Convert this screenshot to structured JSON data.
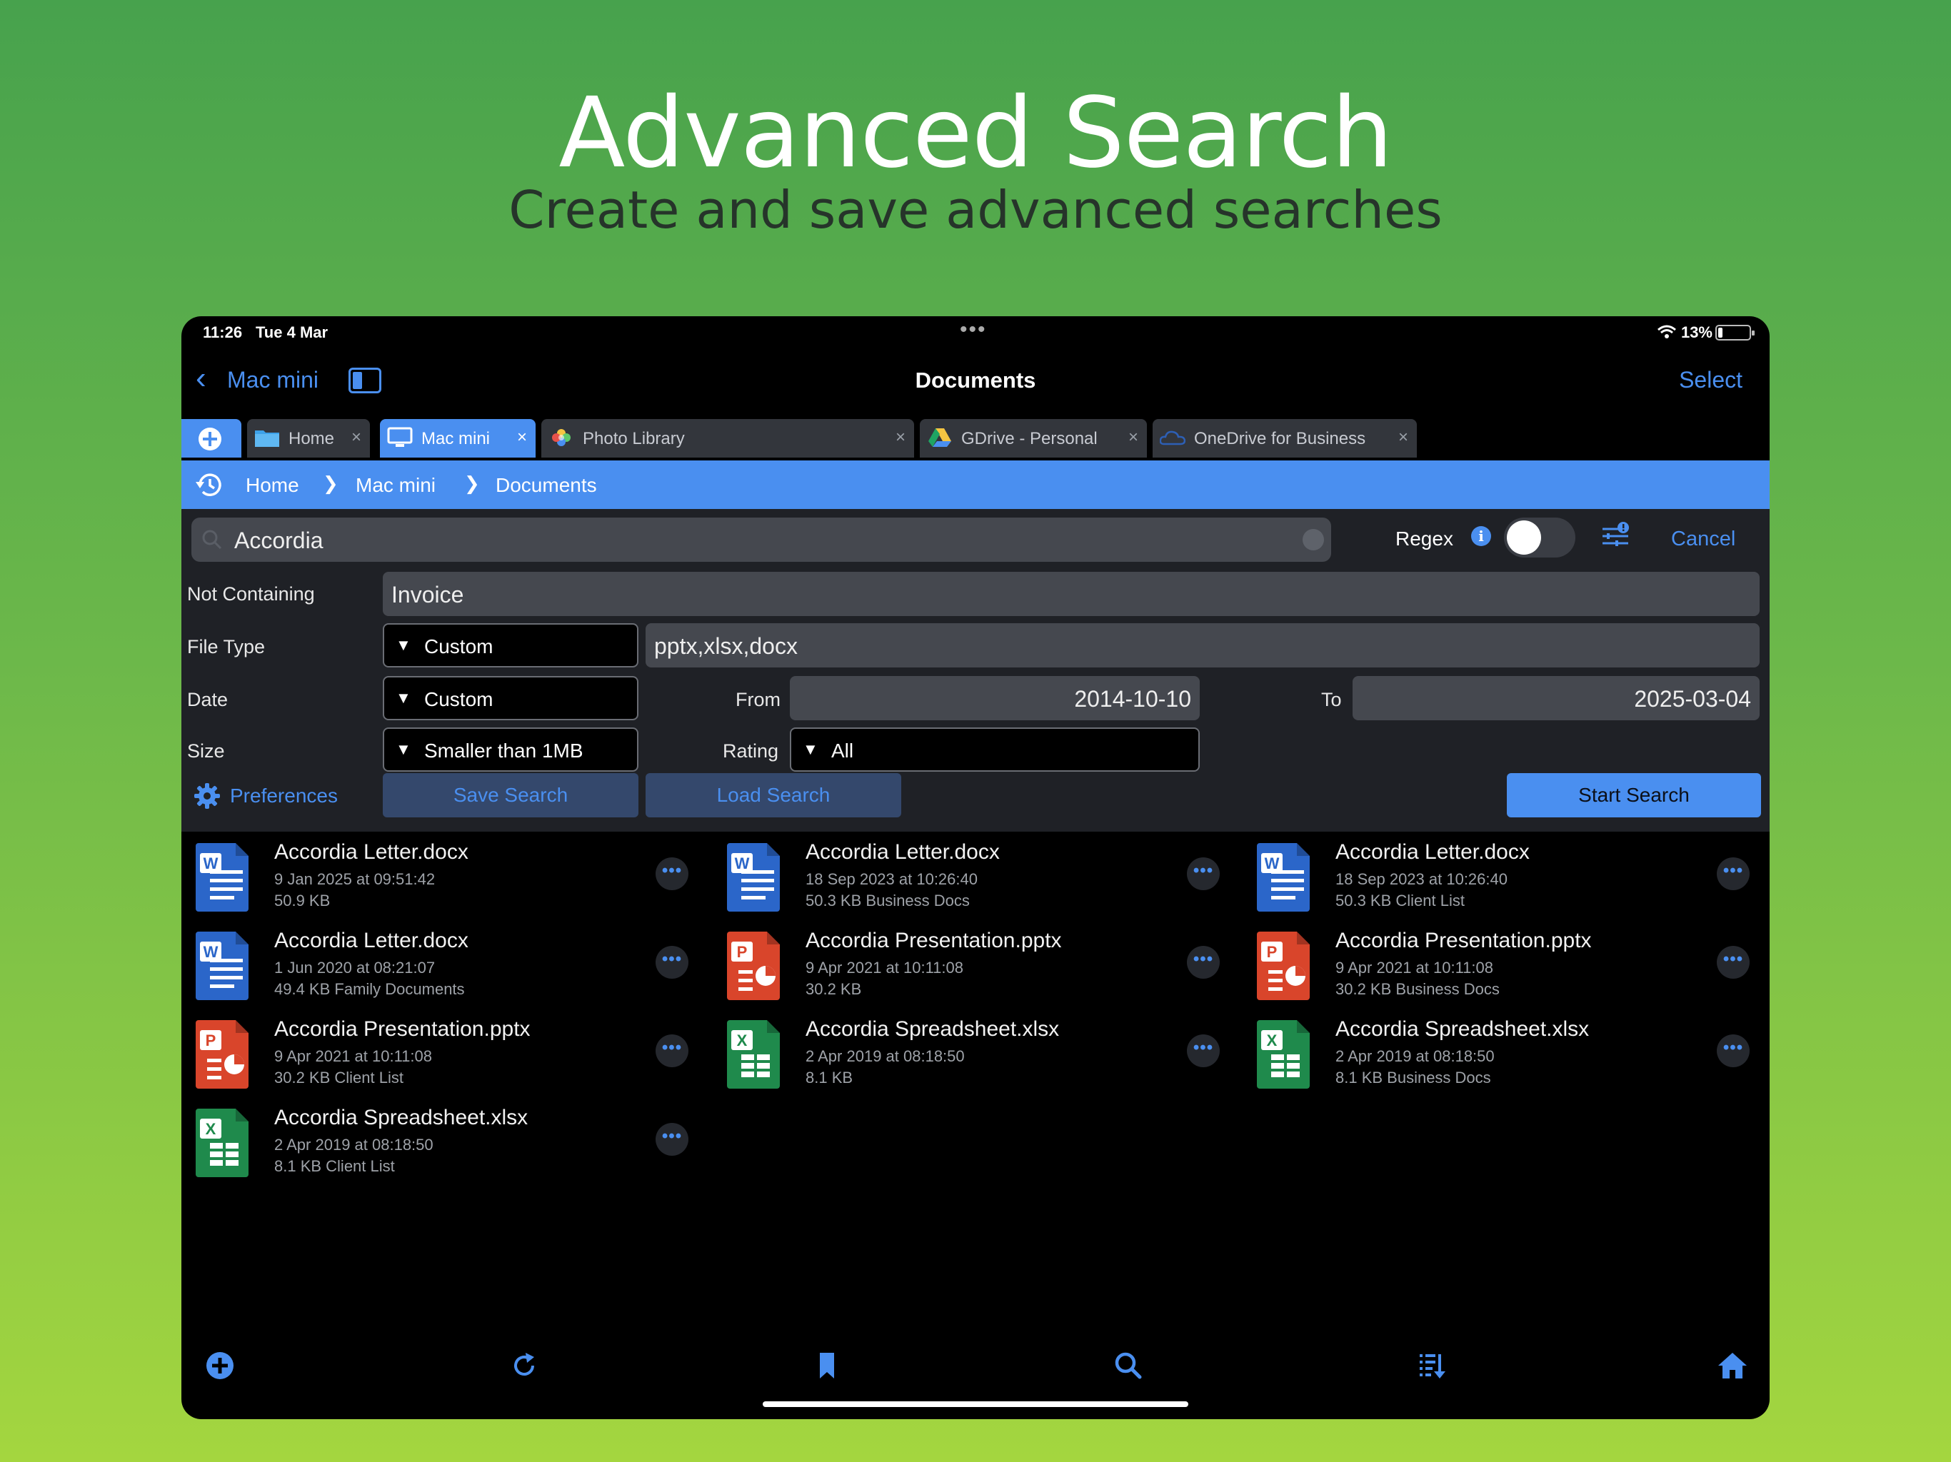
{
  "promo": {
    "title": "Advanced Search",
    "subtitle": "Create and save advanced searches"
  },
  "status_bar": {
    "time": "11:26",
    "date": "Tue 4 Mar",
    "battery": "13%"
  },
  "nav": {
    "back_label": "Mac mini",
    "title": "Documents",
    "select_label": "Select"
  },
  "tabs": [
    {
      "label": "Home",
      "icon": "folder-icon",
      "active": false
    },
    {
      "label": "Mac mini",
      "icon": "computer-icon",
      "active": true
    },
    {
      "label": "Photo Library",
      "icon": "photos-icon",
      "active": false
    },
    {
      "label": "GDrive - Personal",
      "icon": "google-drive-icon",
      "active": false
    },
    {
      "label": "OneDrive for Business",
      "icon": "cloud-icon",
      "active": false
    }
  ],
  "tab_close_glyph": "×",
  "breadcrumb": {
    "items": [
      "Home",
      "Mac mini",
      "Documents"
    ],
    "separator": "❯"
  },
  "search": {
    "query": "Accordia",
    "regex_label": "Regex",
    "regex_enabled": false,
    "cancel_label": "Cancel",
    "not_containing_label": "Not Containing",
    "not_containing_value": "Invoice",
    "file_type_label": "File Type",
    "file_type_selected": "Custom",
    "file_type_value": "pptx,xlsx,docx",
    "date_label": "Date",
    "date_selected": "Custom",
    "from_label": "From",
    "from_value": "2014-10-10",
    "to_label": "To",
    "to_value": "2025-03-04",
    "size_label": "Size",
    "size_selected": "Smaller than 1MB",
    "rating_label": "Rating",
    "rating_selected": "All",
    "preferences_label": "Preferences",
    "save_label": "Save Search",
    "load_label": "Load Search",
    "start_label": "Start Search",
    "dropdown_glyph": "▼"
  },
  "results": [
    {
      "name": "Accordia Letter.docx",
      "date": "9 Jan 2025 at 09:51:42",
      "meta": "50.9 KB",
      "type": "word"
    },
    {
      "name": "Accordia Letter.docx",
      "date": "18 Sep 2023 at 10:26:40",
      "meta": "50.3 KB  Business Docs",
      "type": "word"
    },
    {
      "name": "Accordia Letter.docx",
      "date": "18 Sep 2023 at 10:26:40",
      "meta": "50.3 KB  Client List",
      "type": "word"
    },
    {
      "name": "Accordia Letter.docx",
      "date": "1 Jun 2020 at 08:21:07",
      "meta": "49.4 KB  Family Documents",
      "type": "word"
    },
    {
      "name": "Accordia Presentation.pptx",
      "date": "9 Apr 2021 at 10:11:08",
      "meta": "30.2 KB",
      "type": "powerpoint"
    },
    {
      "name": "Accordia Presentation.pptx",
      "date": "9 Apr 2021 at 10:11:08",
      "meta": "30.2 KB  Business Docs",
      "type": "powerpoint"
    },
    {
      "name": "Accordia Presentation.pptx",
      "date": "9 Apr 2021 at 10:11:08",
      "meta": "30.2 KB  Client List",
      "type": "powerpoint"
    },
    {
      "name": "Accordia Spreadsheet.xlsx",
      "date": "2 Apr 2019 at 08:18:50",
      "meta": "8.1 KB",
      "type": "excel"
    },
    {
      "name": "Accordia Spreadsheet.xlsx",
      "date": "2 Apr 2019 at 08:18:50",
      "meta": "8.1 KB  Business Docs",
      "type": "excel"
    },
    {
      "name": "Accordia Spreadsheet.xlsx",
      "date": "2 Apr 2019 at 08:18:50",
      "meta": "8.1 KB  Client List",
      "type": "excel"
    }
  ],
  "more_glyph": "•••",
  "toolbar": [
    "add-icon",
    "refresh-icon",
    "bookmark-icon",
    "search-icon",
    "sort-icon",
    "home-icon"
  ],
  "colors": {
    "accent": "#4a8ff0",
    "word": "#2b66c9",
    "powerpoint": "#d9452b",
    "excel": "#1f8a4c"
  }
}
